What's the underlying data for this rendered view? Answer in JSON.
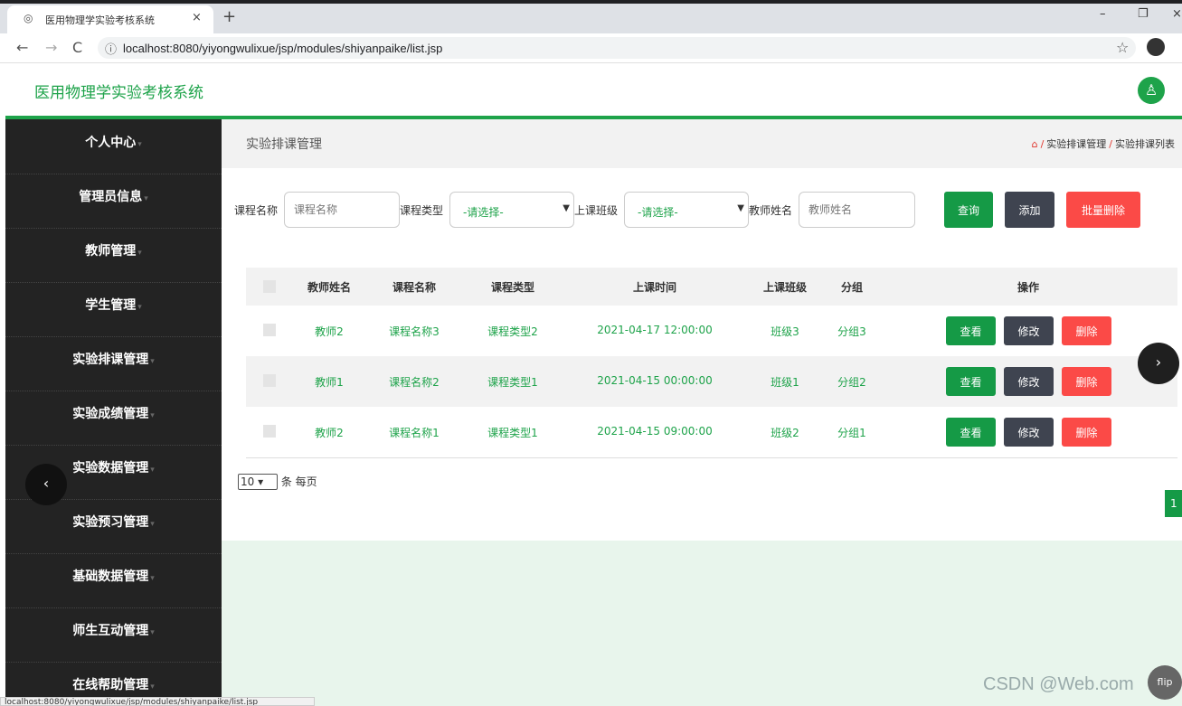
{
  "browser": {
    "tab_title": "医用物理学实验考核系统",
    "tab_close": "×",
    "new_tab": "+",
    "url": "localhost:8080/yiyongwulixue/jsp/modules/shiyanpaike/list.jsp",
    "status_text": "localhost:8080/yiyongwulixue/jsp/modules/shiyanpaike/list.jsp"
  },
  "app": {
    "title": "医用物理学实验考核系统"
  },
  "sidebar": {
    "items": [
      {
        "label": "个人中心"
      },
      {
        "label": "管理员信息"
      },
      {
        "label": "教师管理"
      },
      {
        "label": "学生管理"
      },
      {
        "label": "实验排课管理"
      },
      {
        "label": "实验成绩管理"
      },
      {
        "label": "实验数据管理"
      },
      {
        "label": "实验预习管理"
      },
      {
        "label": "基础数据管理"
      },
      {
        "label": "师生互动管理"
      },
      {
        "label": "在线帮助管理"
      }
    ]
  },
  "page": {
    "title": "实验排课管理",
    "breadcrumb": [
      "实验排课管理",
      "实验排课列表"
    ]
  },
  "search": {
    "course_name_label": "课程名称",
    "course_name_placeholder": "课程名称",
    "course_type_label": "课程类型",
    "course_type_value": "-请选择-",
    "class_label": "上课班级",
    "class_value": "-请选择-",
    "teacher_label": "教师姓名",
    "teacher_placeholder": "教师姓名",
    "query_button": "查询",
    "add_button": "添加",
    "batch_delete_button": "批量删除"
  },
  "table": {
    "headers": [
      "教师姓名",
      "课程名称",
      "课程类型",
      "上课时间",
      "上课班级",
      "分组",
      "操作"
    ],
    "rows": [
      {
        "teacher": "教师2",
        "course": "课程名称3",
        "type": "课程类型2",
        "time": "2021-04-17 12:00:00",
        "class": "班级3",
        "group": "分组3"
      },
      {
        "teacher": "教师1",
        "course": "课程名称2",
        "type": "课程类型1",
        "time": "2021-04-15 00:00:00",
        "class": "班级1",
        "group": "分组2"
      },
      {
        "teacher": "教师2",
        "course": "课程名称1",
        "type": "课程类型1",
        "time": "2021-04-15 09:00:00",
        "class": "班级2",
        "group": "分组1"
      }
    ],
    "row_actions": {
      "view": "查看",
      "edit": "修改",
      "delete": "删除"
    }
  },
  "pagination": {
    "page_size": "10",
    "page_size_suffix": "条 每页",
    "current_page": "1"
  },
  "watermark": "CSDN @Web.com",
  "flip_label": "flip",
  "colors": {
    "brand": "#1ea34a",
    "primary_button": "#159a46",
    "dark_button": "#3f4450",
    "danger_button": "#fb4a47",
    "sidebar_bg": "#232323"
  }
}
